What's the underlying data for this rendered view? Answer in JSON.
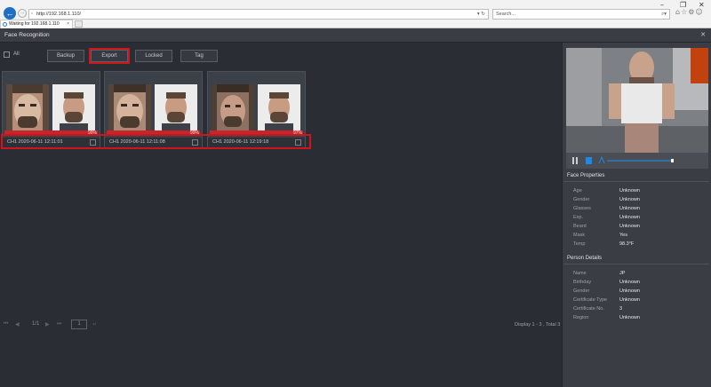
{
  "browser": {
    "url": "http://192.168.1.110/",
    "search_placeholder": "Search...",
    "tab_title": "Waiting for 192.168.1.110",
    "window_controls": [
      "–",
      "❐",
      "✕"
    ]
  },
  "app": {
    "title": "Face Recognition"
  },
  "toolbar": {
    "all_label": "All",
    "buttons": [
      "Backup",
      "Export",
      "Locked",
      "Tag"
    ]
  },
  "cards": [
    {
      "timestamp": "CH1 2020-06-11 12:11:01",
      "similarity": "99%"
    },
    {
      "timestamp": "CH1 2020-06-11 12:11:08",
      "similarity": "99%"
    },
    {
      "timestamp": "CH1 2020-06-11 12:19:18",
      "similarity": "97%"
    }
  ],
  "pager": {
    "page_info": "1/1",
    "display_text": "Display 1 - 3 , Total 3"
  },
  "face_properties": {
    "heading": "Face Properties",
    "items": [
      {
        "key": "Age",
        "value": "Unknown"
      },
      {
        "key": "Gender",
        "value": "Unknown"
      },
      {
        "key": "Glasses",
        "value": "Unknown"
      },
      {
        "key": "Exp.",
        "value": "Unknown"
      },
      {
        "key": "Beard",
        "value": "Unknown"
      },
      {
        "key": "Mask",
        "value": "Yes"
      },
      {
        "key": "Temp",
        "value": "98.3°F"
      }
    ]
  },
  "person_details": {
    "heading": "Person Details",
    "items": [
      {
        "key": "Name",
        "value": "JP"
      },
      {
        "key": "Birthday",
        "value": "Unknown"
      },
      {
        "key": "Gender",
        "value": "Unknown"
      },
      {
        "key": "Certificate Type",
        "value": "Unknown"
      },
      {
        "key": "Certificate No.",
        "value": "3"
      },
      {
        "key": "Region",
        "value": "Unknown"
      }
    ]
  },
  "colors": {
    "highlight": "#d01419",
    "accent": "#1e88e5"
  },
  "playback": {
    "progress": 0.96
  }
}
